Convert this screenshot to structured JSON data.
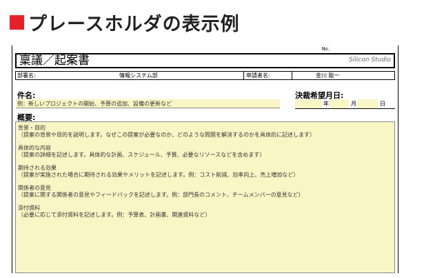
{
  "page_heading": "プレースホルダの表示例",
  "colors": {
    "heading_mark": "#e8202a",
    "field_fill": "#faf5c5"
  },
  "form": {
    "no_label": "No.",
    "title": "稟議／起案書",
    "logo_text": "Silicon Studio",
    "logo_icon": "silicon-studio-logo-icon",
    "department_label": "部署名:",
    "department_value": "情報システム部",
    "applicant_label": "申請者名:",
    "applicant_value": "金川 聡一",
    "subject_label": "件名:",
    "subject_placeholder": "例：新しいプロジェクトの開始、予算の追加、設備の更新など",
    "desired_date_label": "決裁希望月日:",
    "date_year": "年",
    "date_month": "月",
    "date_day": "日",
    "overview_label": "概要:",
    "overview_sections": [
      {
        "title": "背景・目的",
        "body": "（提案の背景や目的を説明します。なぜこの提案が必要なのか、どのような問題を解決するのかを具体的に記述します）"
      },
      {
        "title": "具体的な内容",
        "body": "（提案の詳細を記述します。具体的な計画、スケジュール、予算、必要なリソースなどを含めます）"
      },
      {
        "title": "期待される効果",
        "body": "（提案が実施された場合に期待される効果やメリットを記述します。例：コスト削減、効率向上、売上増加など）"
      },
      {
        "title": "関係者の意見",
        "body": "（提案に関する関係者の意見やフィードバックを記述します。例：部門長のコメント、チームメンバーの意見など）"
      },
      {
        "title": "添付資料",
        "body": "（必要に応じて添付資料を記述します。例：予算表、計画書、関連資料など）"
      }
    ]
  }
}
